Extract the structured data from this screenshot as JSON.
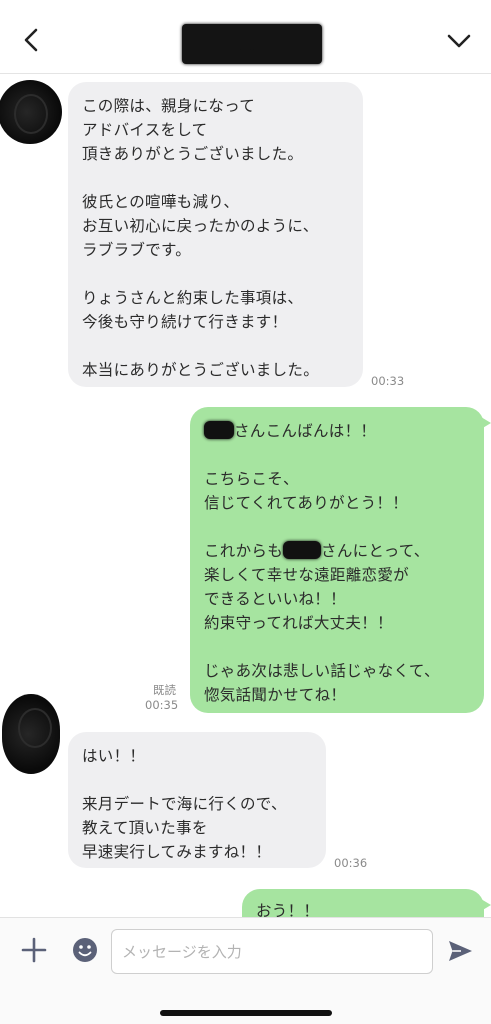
{
  "header": {
    "title": "■■■■",
    "back_icon": "chevron-left-icon",
    "menu_icon": "chevron-down-icon"
  },
  "messages": {
    "m1": {
      "text": "この際は、親身になって\nアドバイスをして\n頂きありがとうございました。\n\n彼氏との喧嘩も減り、\nお互い初心に戻ったかのように、\nラブラブです。\n\nりょうさんと約束した事項は、\n今後も守り続けて行きます！\n\n本当にありがとうございました。",
      "time": "00:33"
    },
    "m2": {
      "line1_suffix": "さんこんばんは！！",
      "block2": "こちらこそ、\n信じてくれてありがとう！！",
      "line3_prefix": "これからも",
      "line3_suffix": "さんにとって、",
      "block3": "楽しくて幸せな遠距離恋愛が\nできるといいね！！\n約束守ってれば大丈夫！！",
      "block4": "じゃあ次は悲しい話じゃなくて、\n惚気話聞かせてね！",
      "read": "既読",
      "time": "00:35"
    },
    "m3": {
      "text": "はい！！\n\n来月デートで海に行くので、\n教えて頂いた事を\n早速実行してみますね！！",
      "time": "00:36"
    },
    "m4": {
      "text": "おう！！"
    }
  },
  "input": {
    "placeholder": "メッセージを入力",
    "value": ""
  },
  "colors": {
    "outgoing_bubble": "#a6e4a0",
    "incoming_bubble": "#efeff1",
    "send_icon": "#5b6178"
  }
}
